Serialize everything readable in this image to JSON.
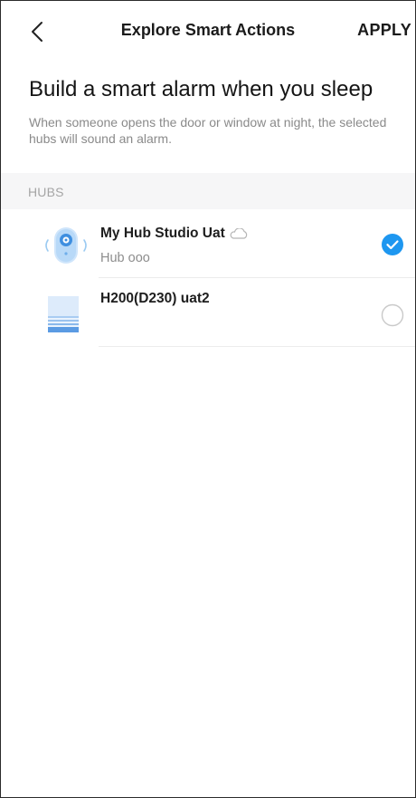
{
  "header": {
    "back_icon": "chevron-left-icon",
    "title": "Explore Smart Actions",
    "apply_label": "APPLY"
  },
  "intro": {
    "heading": "Build a smart alarm when you sleep",
    "description": "When someone opens the door or window at night, the selected hubs will sound an alarm."
  },
  "section": {
    "label": "HUBS"
  },
  "hubs": [
    {
      "name": "My Hub Studio Uat",
      "subtitle": "Hub ooo",
      "icon": "hub-speaker-icon",
      "status_icon": "cloud-icon",
      "selected": true
    },
    {
      "name": "H200(D230) uat2",
      "subtitle": "",
      "icon": "hub-box-icon",
      "selected": false
    }
  ],
  "colors": {
    "accent": "#1E97F0",
    "text_primary": "#1B1B1B",
    "text_secondary": "#8A8A8A",
    "section_bg": "#F6F6F7",
    "divider": "#ECECEC"
  }
}
